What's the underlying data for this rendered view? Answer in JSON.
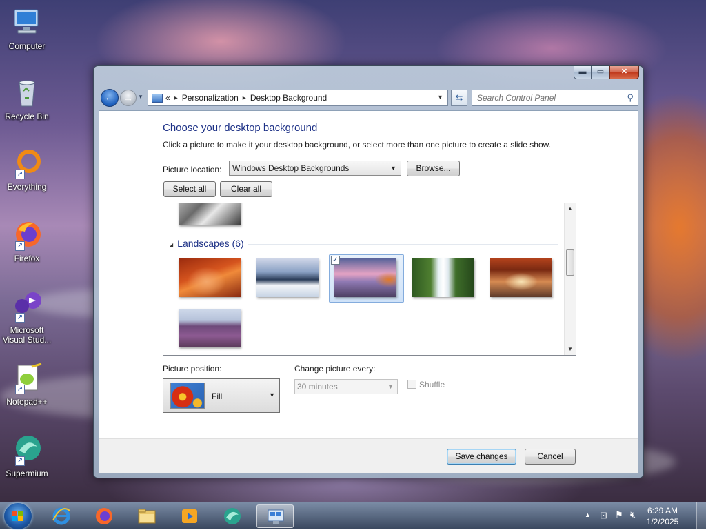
{
  "desktop": {
    "icons": [
      {
        "label": "Computer"
      },
      {
        "label": "Recycle Bin"
      },
      {
        "label": "Everything"
      },
      {
        "label": "Firefox"
      },
      {
        "label": "Microsoft Visual Stud..."
      },
      {
        "label": "Notepad++"
      },
      {
        "label": "Supermium"
      }
    ]
  },
  "window": {
    "caption_buttons": {
      "minimize": "▬",
      "maximize": "▭",
      "close": "✕"
    },
    "address": {
      "prefix": "«",
      "crumbs": [
        "Personalization",
        "Desktop Background"
      ],
      "separator": "▸"
    },
    "search": {
      "placeholder": "Search Control Panel"
    },
    "content": {
      "heading": "Choose your desktop background",
      "description": "Click a picture to make it your desktop background, or select more than one picture to create a slide show.",
      "picture_location_label": "Picture location:",
      "picture_location_value": "Windows Desktop Backgrounds",
      "browse_label": "Browse...",
      "select_all_label": "Select all",
      "clear_all_label": "Clear all",
      "group_title": "Landscapes (6)",
      "picture_position_label": "Picture position:",
      "picture_position_value": "Fill",
      "change_picture_label": "Change picture every:",
      "change_picture_value": "30 minutes",
      "shuffle_label": "Shuffle"
    },
    "footer": {
      "save_label": "Save changes",
      "cancel_label": "Cancel"
    }
  },
  "taskbar": {
    "apps": [
      "Internet Explorer",
      "Firefox",
      "File Explorer",
      "Media Player",
      "Supermium",
      "Control Panel"
    ],
    "clock": {
      "time": "6:29 AM",
      "date": "1/2/2025"
    }
  }
}
